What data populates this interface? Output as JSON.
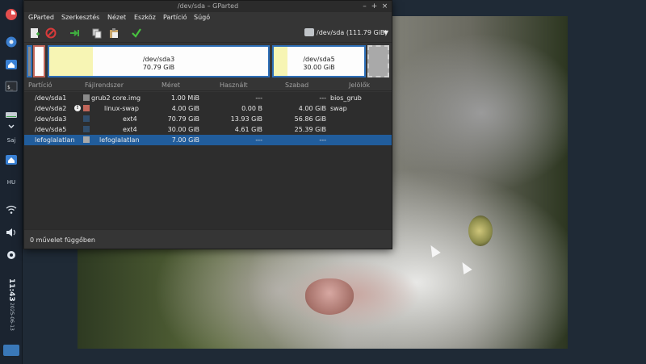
{
  "panel": {
    "labels": [
      "Saj",
      "HU"
    ],
    "clock_time": "11:43",
    "clock_date": "2025-06-13"
  },
  "window": {
    "title": "/dev/sda – GParted",
    "menu": [
      "GParted",
      "Szerkesztés",
      "Nézet",
      "Eszköz",
      "Partíció",
      "Súgó"
    ],
    "device": "/dev/sda (111.79 GiB)",
    "map": [
      {
        "name": "/dev/sda3",
        "size": "70.79 GiB",
        "used_fraction": 0.2
      },
      {
        "name": "/dev/sda5",
        "size": "30.00 GiB",
        "used_fraction": 0.15
      }
    ],
    "columns": [
      "Partíció",
      "Fájlrendszer",
      "Méret",
      "Használt",
      "Szabad",
      "Jelölők"
    ],
    "rows": [
      {
        "partition": "/dev/sda1",
        "fs": "grub2 core.img",
        "size": "1.00 MiB",
        "used": "---",
        "free": "---",
        "flags": "bios_grub",
        "color": "#8a8a8a",
        "warn": false,
        "selected": false
      },
      {
        "partition": "/dev/sda2",
        "fs": "linux-swap",
        "size": "4.00 GiB",
        "used": "0.00 B",
        "free": "4.00 GiB",
        "flags": "swap",
        "color": "#c1665a",
        "warn": true,
        "selected": false
      },
      {
        "partition": "/dev/sda3",
        "fs": "ext4",
        "size": "70.79 GiB",
        "used": "13.93 GiB",
        "free": "56.86 GiB",
        "flags": "",
        "color": "#314e6c",
        "warn": false,
        "selected": false
      },
      {
        "partition": "/dev/sda5",
        "fs": "ext4",
        "size": "30.00 GiB",
        "used": "4.61 GiB",
        "free": "25.39 GiB",
        "flags": "",
        "color": "#314e6c",
        "warn": false,
        "selected": false
      },
      {
        "partition": "lefoglalatlan",
        "fs": "lefoglalatlan",
        "size": "7.00 GiB",
        "used": "---",
        "free": "---",
        "flags": "",
        "color": "#a9a9a9",
        "warn": false,
        "selected": true
      }
    ],
    "status": "0 művelet függőben"
  }
}
